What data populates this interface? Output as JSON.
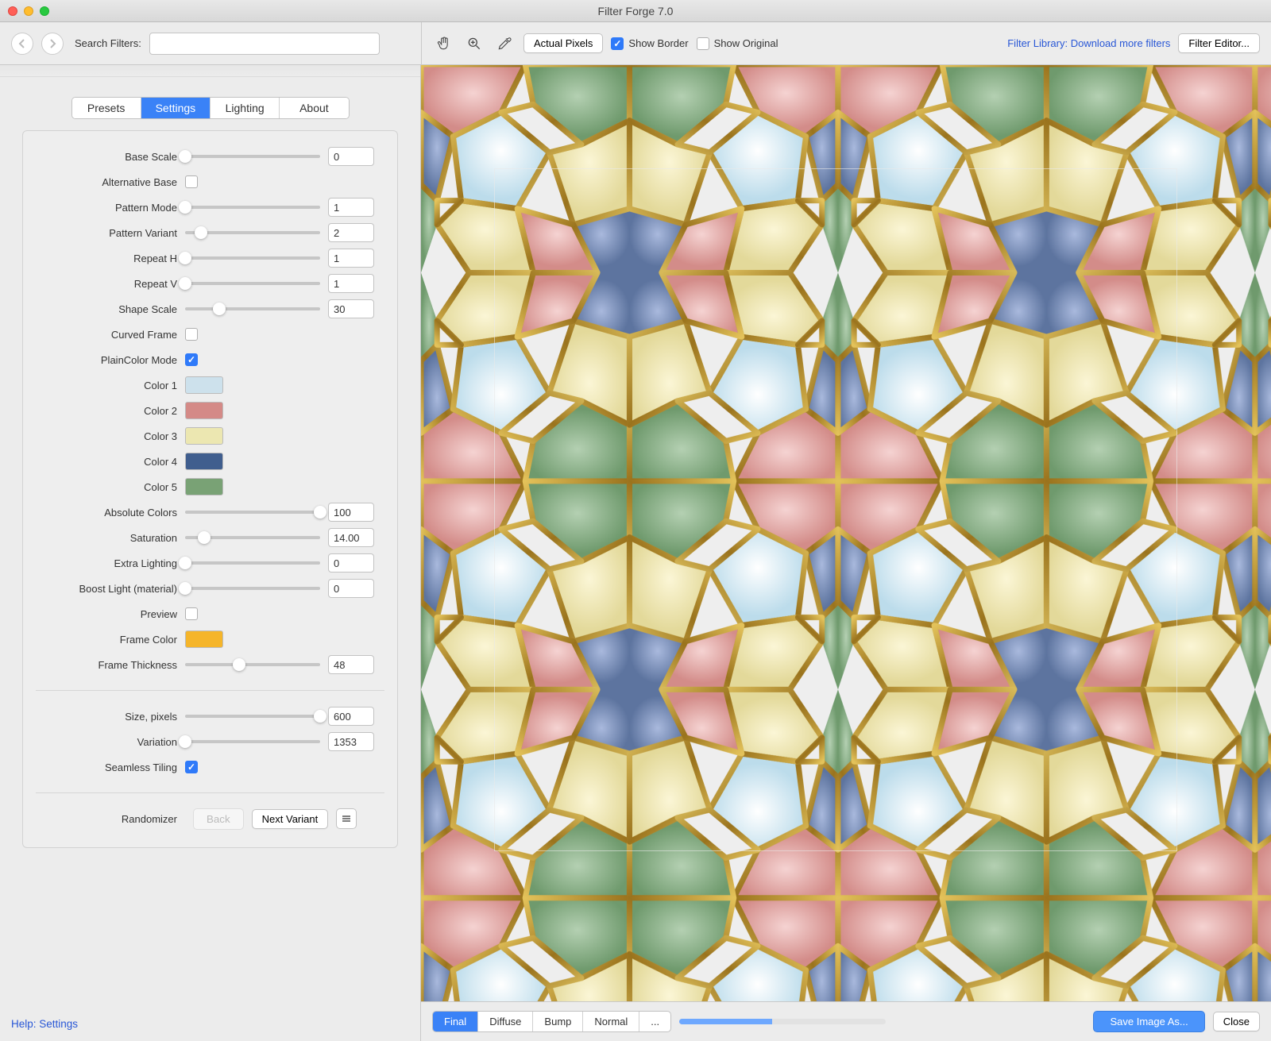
{
  "window": {
    "title": "Filter Forge 7.0"
  },
  "toolbar_left": {
    "search_label": "Search Filters:",
    "search_value": ""
  },
  "toolbar_right": {
    "actual_pixels": "Actual Pixels",
    "show_border": "Show Border",
    "show_border_checked": true,
    "show_original": "Show Original",
    "show_original_checked": false,
    "library_link": "Filter Library: Download more filters",
    "filter_editor": "Filter Editor..."
  },
  "tabs": {
    "presets": "Presets",
    "settings": "Settings",
    "lighting": "Lighting",
    "about": "About",
    "active": "Settings"
  },
  "settings": {
    "base_scale": {
      "label": "Base Scale",
      "value": "0",
      "pos": 0
    },
    "alternative_base": {
      "label": "Alternative Base",
      "checked": false
    },
    "pattern_mode": {
      "label": "Pattern Mode",
      "value": "1",
      "pos": 0
    },
    "pattern_variant": {
      "label": "Pattern Variant",
      "value": "2",
      "pos": 12
    },
    "repeat_h": {
      "label": "Repeat H",
      "value": "1",
      "pos": 0
    },
    "repeat_v": {
      "label": "Repeat V",
      "value": "1",
      "pos": 0
    },
    "shape_scale": {
      "label": "Shape Scale",
      "value": "30",
      "pos": 25
    },
    "curved_frame": {
      "label": "Curved Frame",
      "checked": false
    },
    "plaincolor_mode": {
      "label": "PlainColor Mode",
      "checked": true
    },
    "color1": {
      "label": "Color 1",
      "hex": "#cde1ec"
    },
    "color2": {
      "label": "Color 2",
      "hex": "#d48a87"
    },
    "color3": {
      "label": "Color 3",
      "hex": "#ece7b1"
    },
    "color4": {
      "label": "Color 4",
      "hex": "#405e8e"
    },
    "color5": {
      "label": "Color 5",
      "hex": "#79a275"
    },
    "absolute_colors": {
      "label": "Absolute Colors",
      "value": "100",
      "pos": 100
    },
    "saturation": {
      "label": "Saturation",
      "value": "14.00",
      "pos": 14
    },
    "extra_lighting": {
      "label": "Extra Lighting",
      "value": "0",
      "pos": 0
    },
    "boost_light": {
      "label": "Boost Light (material)",
      "value": "0",
      "pos": 0
    },
    "preview": {
      "label": "Preview",
      "checked": false
    },
    "frame_color": {
      "label": "Frame Color",
      "hex": "#f5b52a"
    },
    "frame_thickness": {
      "label": "Frame Thickness",
      "value": "48",
      "pos": 40
    },
    "size_pixels": {
      "label": "Size, pixels",
      "value": "600",
      "pos": 100
    },
    "variation": {
      "label": "Variation",
      "value": "1353",
      "pos": 0
    },
    "seamless_tiling": {
      "label": "Seamless Tiling",
      "checked": true
    },
    "randomizer": {
      "label": "Randomizer",
      "back": "Back",
      "next": "Next Variant"
    }
  },
  "help_link": "Help: Settings",
  "bottom": {
    "final": "Final",
    "diffuse": "Diffuse",
    "bump": "Bump",
    "normal": "Normal",
    "more": "...",
    "save": "Save Image As...",
    "close": "Close"
  },
  "preview": {
    "colors": {
      "gold": "#b58c2a",
      "gold_hi": "#e3c86a",
      "pink": "#e5a8a6",
      "blue": "#7f95c6",
      "lightblue": "#d4e8f2",
      "cream": "#eee6b8",
      "green": "#8bb089"
    }
  }
}
